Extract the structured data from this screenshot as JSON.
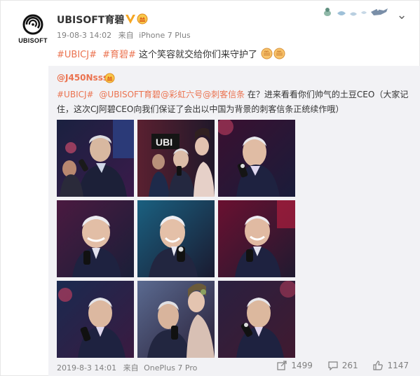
{
  "post": {
    "user_name": "UBISOFT育碧",
    "avatar_text": "UBISOFT",
    "time": "19-08-3 14:02",
    "source_prefix": "来自",
    "source": "iPhone 7 Plus",
    "topic1": "#UBICJ#",
    "topic2": "#育碧#",
    "text": " 这个笑容就交给你们来守护了"
  },
  "repost": {
    "user": "@J450Nsss",
    "topic": "#UBICJ#",
    "mention1": "@UBISOFT育碧",
    "mention2": "@彩虹六号",
    "mention3": "@刺客信条",
    "text_line1_rest": " 在？进来看看你们帅气的土豆CEO（大家记",
    "text_line2": "住，这次CJ阿碧CEO向我们保证了会出以中国为背景的刺客信条正统续作哦）",
    "time": "2019-8-3 14:01",
    "source_prefix": "来自",
    "source": "OnePlus 7 Pro",
    "shares": "1499",
    "comments": "261",
    "likes": "1147"
  },
  "photos": [
    {
      "name": "photo-1"
    },
    {
      "name": "photo-2"
    },
    {
      "name": "photo-3"
    },
    {
      "name": "photo-4"
    },
    {
      "name": "photo-5"
    },
    {
      "name": "photo-6"
    },
    {
      "name": "photo-7"
    },
    {
      "name": "photo-8"
    },
    {
      "name": "photo-9"
    }
  ],
  "icons": {
    "share": "share-icon",
    "comment": "comment-icon",
    "like": "like-icon",
    "close": "close-icon"
  },
  "colors": {
    "link": "#eb7350",
    "meta": "#808080",
    "repost_bg": "#f2f2f5",
    "verified": "#f5a623"
  }
}
